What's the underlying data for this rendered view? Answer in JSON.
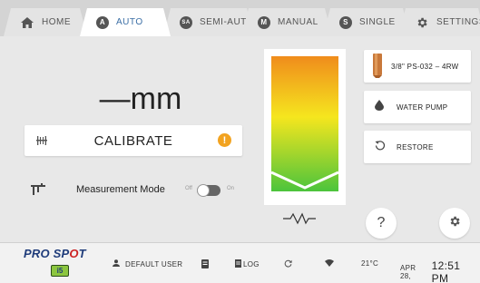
{
  "tabs": [
    {
      "label": "HOME",
      "icon": "home-icon",
      "badge": ""
    },
    {
      "label": "AUTO",
      "icon": "auto-badge-icon",
      "badge": "A"
    },
    {
      "label": "SEMI-AUTO",
      "icon": "semi-auto-badge-icon",
      "badge": "SA"
    },
    {
      "label": "MANUAL",
      "icon": "manual-badge-icon",
      "badge": "M"
    },
    {
      "label": "SINGLE",
      "icon": "single-badge-icon",
      "badge": "S"
    },
    {
      "label": "SETTINGS",
      "icon": "gear-icon",
      "badge": ""
    }
  ],
  "active_tab": "AUTO",
  "measurement": {
    "value": "—mm"
  },
  "calibrate": {
    "label": "CALIBRATE",
    "warning_symbol": "!"
  },
  "measurement_mode": {
    "label": "Measurement Mode",
    "off_label": "Off",
    "on_label": "On",
    "state": "off"
  },
  "gauge": {
    "colors": [
      "#f08c1c",
      "#f5e61e",
      "#4cc43c"
    ]
  },
  "right_panel": {
    "tip_label": "3/8\" PS-032 – 4RW",
    "pump_label": "WATER PUMP",
    "restore_label": "RESTORE",
    "help_symbol": "?"
  },
  "footer": {
    "brand_top": "PRO SP",
    "brand_o": "O",
    "brand_end": "T",
    "brand_sub": "i5",
    "user": "DEFAULT USER",
    "log": "LOG",
    "temperature": "21°C",
    "date": "APR 28,",
    "time": "12:51 PM"
  },
  "colors": {
    "accent": "#3a6ea5",
    "warning": "#f2a320",
    "brand": "#1f3c7a"
  }
}
